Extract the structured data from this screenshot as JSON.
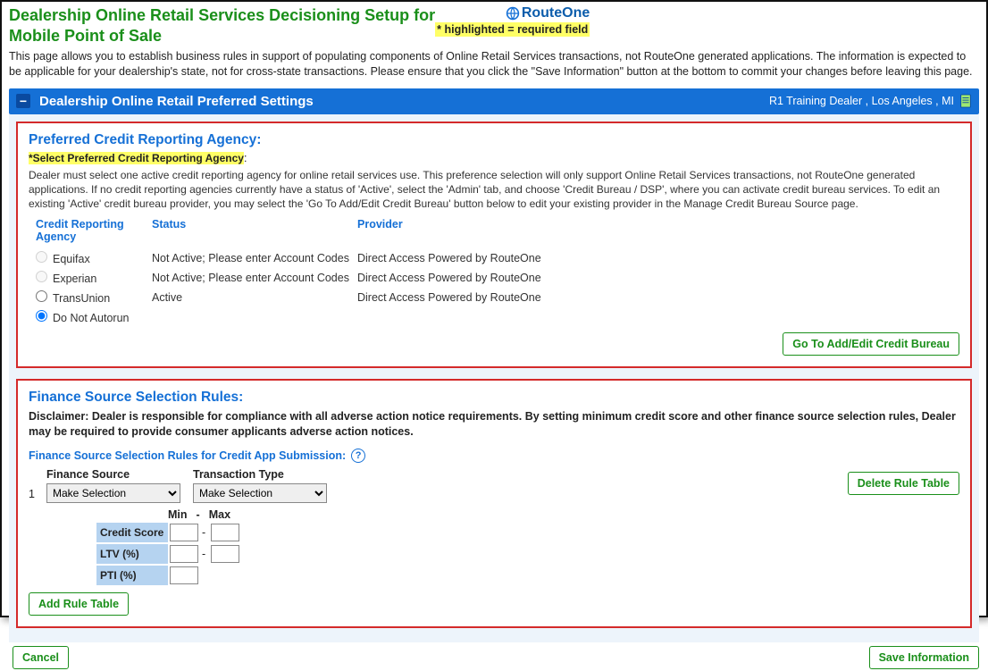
{
  "header": {
    "title_line1": "Dealership Online Retail Services Decisioning Setup for",
    "title_line2": "Mobile Point of Sale",
    "logo_text": "RouteOne",
    "required_note": "* highlighted = required field",
    "intro": "This page allows you to establish business rules in support of populating components of Online Retail Services transactions, not RouteOne generated applications. The information is expected to be applicable for your dealership's state, not for cross-state transactions. Please ensure that you click the \"Save Information\" button at the bottom to commit your changes before leaving this page."
  },
  "section_bar": {
    "collapse_glyph": "−",
    "title": "Dealership Online Retail Preferred Settings",
    "dealer_location": "R1 Training Dealer , Los Angeles , MI"
  },
  "cra": {
    "title": "Preferred Credit Reporting Agency:",
    "select_label": "*Select Preferred Credit Reporting Agency",
    "desc": "Dealer must select one active credit reporting agency for online retail services use. This preference selection will only support Online Retail Services transactions, not RouteOne generated applications. If no credit reporting agencies currently have a status of 'Active', select the 'Admin' tab, and choose 'Credit Bureau / DSP', where you can activate credit bureau services. To edit an existing 'Active' credit bureau provider, you may select the 'Go To Add/Edit Credit Bureau' button below to edit your existing provider in the Manage Credit Bureau Source page.",
    "headers": {
      "agency": "Credit Reporting Agency",
      "status": "Status",
      "provider": "Provider"
    },
    "rows": [
      {
        "agency": "Equifax",
        "status": "Not Active; Please enter Account Codes",
        "provider": "Direct Access Powered by RouteOne",
        "disabled": true,
        "checked": false
      },
      {
        "agency": "Experian",
        "status": "Not Active; Please enter Account Codes",
        "provider": "Direct Access Powered by RouteOne",
        "disabled": true,
        "checked": false
      },
      {
        "agency": "TransUnion",
        "status": "Active",
        "provider": "Direct Access Powered by RouteOne",
        "disabled": false,
        "checked": false
      },
      {
        "agency": "Do Not Autorun",
        "status": "",
        "provider": "",
        "disabled": false,
        "checked": true
      }
    ],
    "goto_btn": "Go To Add/Edit Credit Bureau"
  },
  "rules": {
    "title": "Finance Source Selection Rules:",
    "disclaimer": "Disclaimer: Dealer is responsible for compliance with all adverse action notice requirements. By setting minimum credit score and other finance source selection rules, Dealer may be required to provide consumer applicants adverse action notices.",
    "subhead": "Finance Source Selection Rules for Credit App Submission:",
    "row_num": "1",
    "cols": {
      "finance_source": "Finance Source",
      "transaction_type": "Transaction Type"
    },
    "default_option": "Make Selection",
    "minmax": {
      "min": "Min",
      "dash": "-",
      "max": "Max",
      "credit_score": "Credit Score",
      "ltv": "LTV (%)",
      "pti": "PTI (%)"
    },
    "delete_btn": "Delete Rule Table",
    "add_btn": "Add Rule Table"
  },
  "footer": {
    "cancel": "Cancel",
    "save": "Save Information"
  }
}
